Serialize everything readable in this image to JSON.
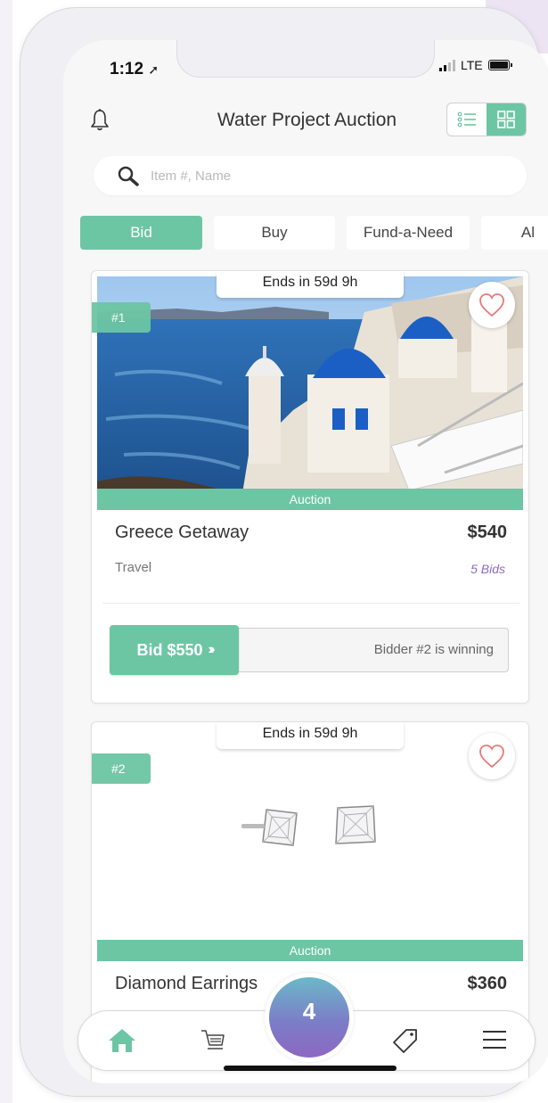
{
  "status_bar": {
    "time": "1:12",
    "network": "LTE"
  },
  "header": {
    "title": "Water Project Auction"
  },
  "search": {
    "placeholder": "Item #, Name"
  },
  "tabs": [
    {
      "label": "Bid",
      "active": true
    },
    {
      "label": "Buy",
      "active": false
    },
    {
      "label": "Fund-a-Need",
      "active": false
    },
    {
      "label": "Al",
      "active": false
    }
  ],
  "items": [
    {
      "ends": "Ends in 59d 9h",
      "number": "#1",
      "type": "Auction",
      "name": "Greece Getaway",
      "price": "$540",
      "category": "Travel",
      "bids": "5 Bids",
      "bid_button": "Bid $550",
      "status": "Bidder #2 is winning"
    },
    {
      "ends": "Ends in 59d 9h",
      "number": "#2",
      "type": "Auction",
      "name": "Diamond Earrings",
      "price": "$360"
    }
  ],
  "bottom_nav": {
    "center_count": "4",
    "items": [
      "home-icon",
      "cart-icon",
      "tag-icon",
      "menu-icon"
    ]
  },
  "colors": {
    "accent": "#6cc6a4",
    "bids": "#8a6cc4",
    "cart_gradient_top": "#6cb8c9",
    "cart_gradient_bottom": "#8d67c2"
  }
}
